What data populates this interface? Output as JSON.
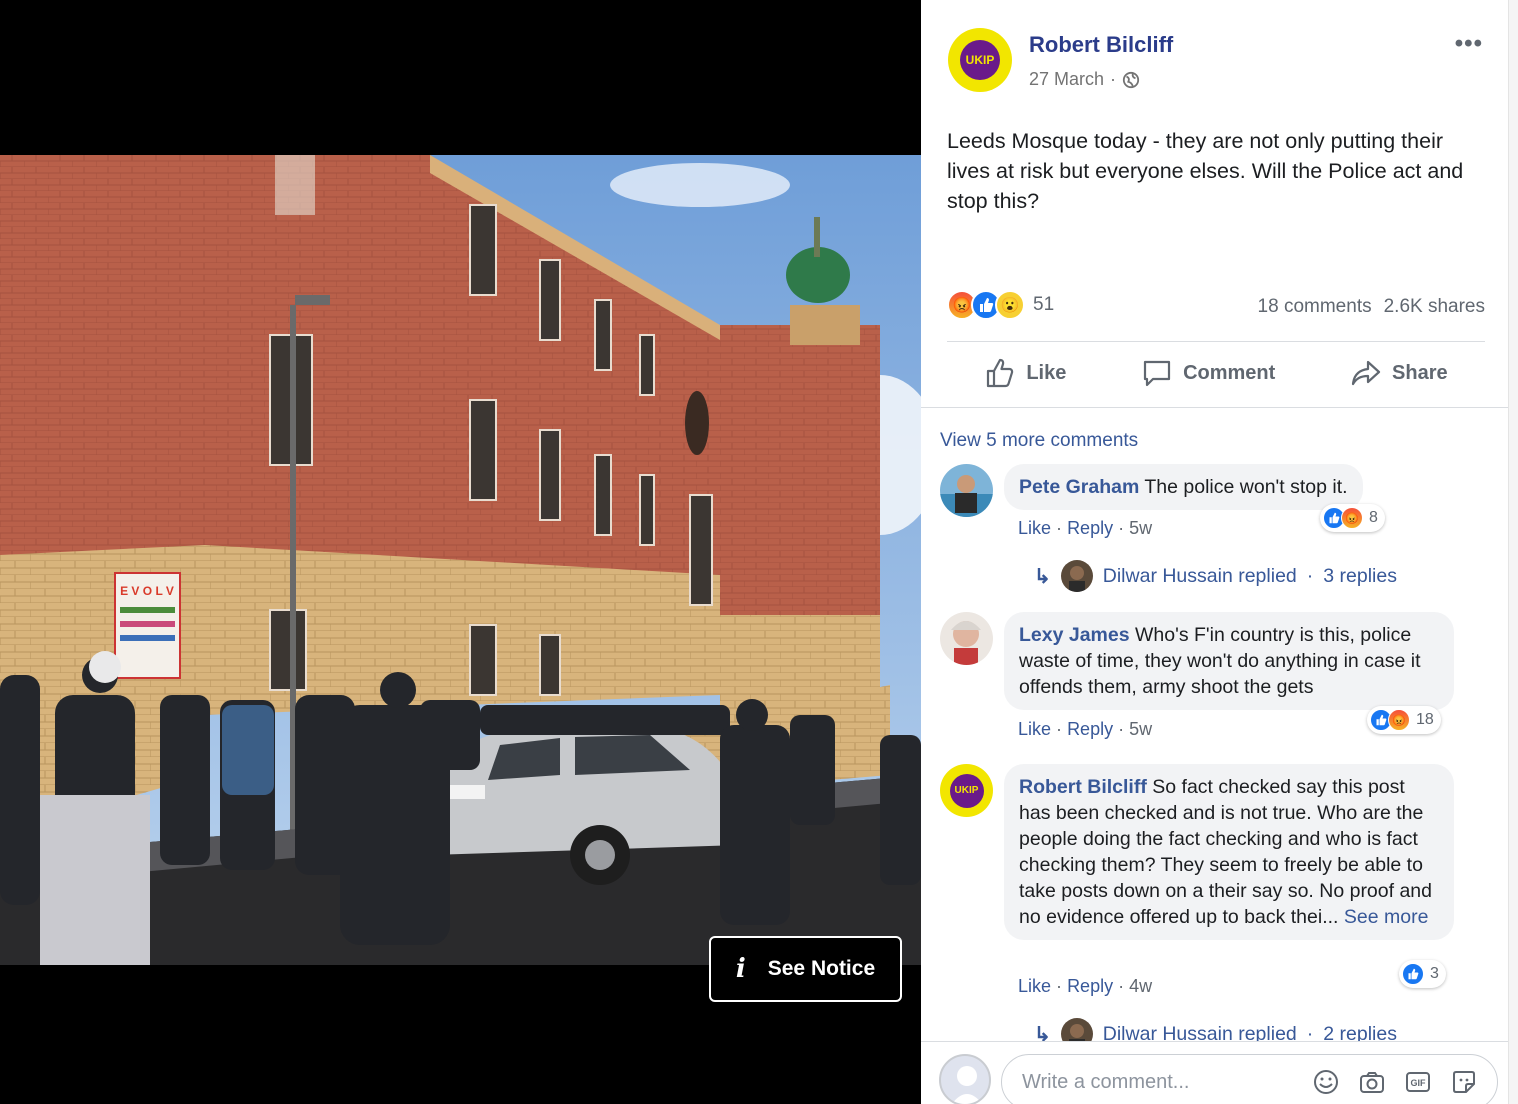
{
  "viewer": {
    "see_notice_label": "See Notice",
    "info_glyph": "i",
    "poster_text": "E V O L V"
  },
  "post": {
    "author": "Robert Bilcliff",
    "date": "27 March",
    "separator": "·",
    "more_glyph": "•••",
    "avatar_text": "UKIP",
    "text": "Leeds Mosque today - they are not only putting their lives at risk but everyone elses. Will the Police act and stop this?",
    "reaction_count": "51",
    "comments_count": "18 comments",
    "shares_count": "2.6K shares",
    "actions": {
      "like": "Like",
      "comment": "Comment",
      "share": "Share"
    },
    "view_more": "View 5 more comments"
  },
  "comments": [
    {
      "author": "Pete Graham",
      "text": "The police won't stop it.",
      "like": "Like",
      "reply": "Reply",
      "time": "5w",
      "sep": "·",
      "reaction_count": "8",
      "replies": {
        "name": "Dilwar Hussain replied",
        "sep": "·",
        "count": "3 replies"
      }
    },
    {
      "author": "Lexy James",
      "text": "Who's F'in country is this, police waste of time, they won't do anything in case it offends them, army shoot the gets",
      "like": "Like",
      "reply": "Reply",
      "time": "5w",
      "sep": "·",
      "reaction_count": "18"
    },
    {
      "author": "Robert Bilcliff",
      "text": "So fact checked say this post has been checked and is not true. Who are the people doing the fact checking and who is fact checking them? They seem to freely be able to take posts down on a their say so. No proof and no evidence offered up to back thei...",
      "see_more": "See more",
      "avatar_text": "UKIP",
      "like": "Like",
      "reply": "Reply",
      "time": "4w",
      "sep": "·",
      "reaction_count": "3",
      "replies": {
        "name": "Dilwar Hussain replied",
        "sep": "·",
        "count": "2 replies"
      }
    }
  ],
  "composer": {
    "placeholder": "Write a comment..."
  },
  "icons": [
    "globe-icon",
    "more-icon",
    "like-icon",
    "comment-icon",
    "share-icon",
    "reply-arrow-icon",
    "emoji-icon",
    "camera-icon",
    "gif-icon",
    "sticker-icon",
    "info-icon"
  ],
  "colors": {
    "link": "#385898",
    "author": "#2b3c8a",
    "like_blue": "#1877f2",
    "ukip_yellow": "#f2e600",
    "ukip_purple": "#6a1a8a"
  }
}
